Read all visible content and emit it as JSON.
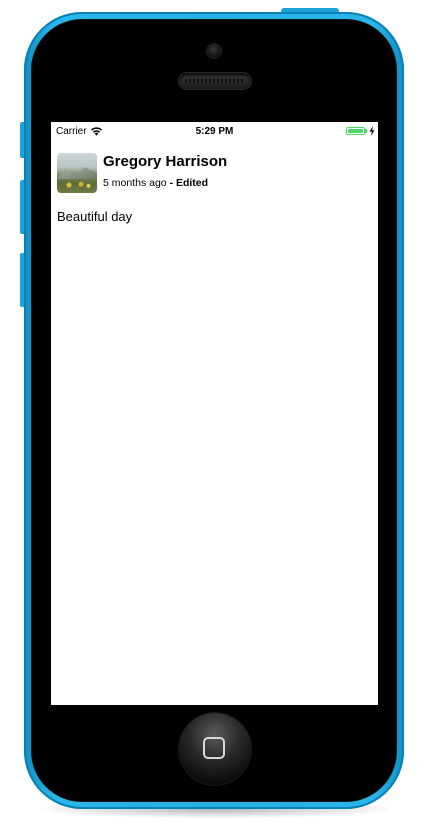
{
  "status_bar": {
    "carrier": "Carrier",
    "time": "5:29 PM",
    "battery_color": "#4cd964"
  },
  "post": {
    "author": "Gregory Harrison",
    "timestamp": "5 months ago",
    "edited_label": "- Edited",
    "body": "Beautiful day",
    "avatar_icon": "landscape-photo"
  },
  "device": {
    "color": "#25b0e6",
    "home_icon": "home-square-icon"
  }
}
